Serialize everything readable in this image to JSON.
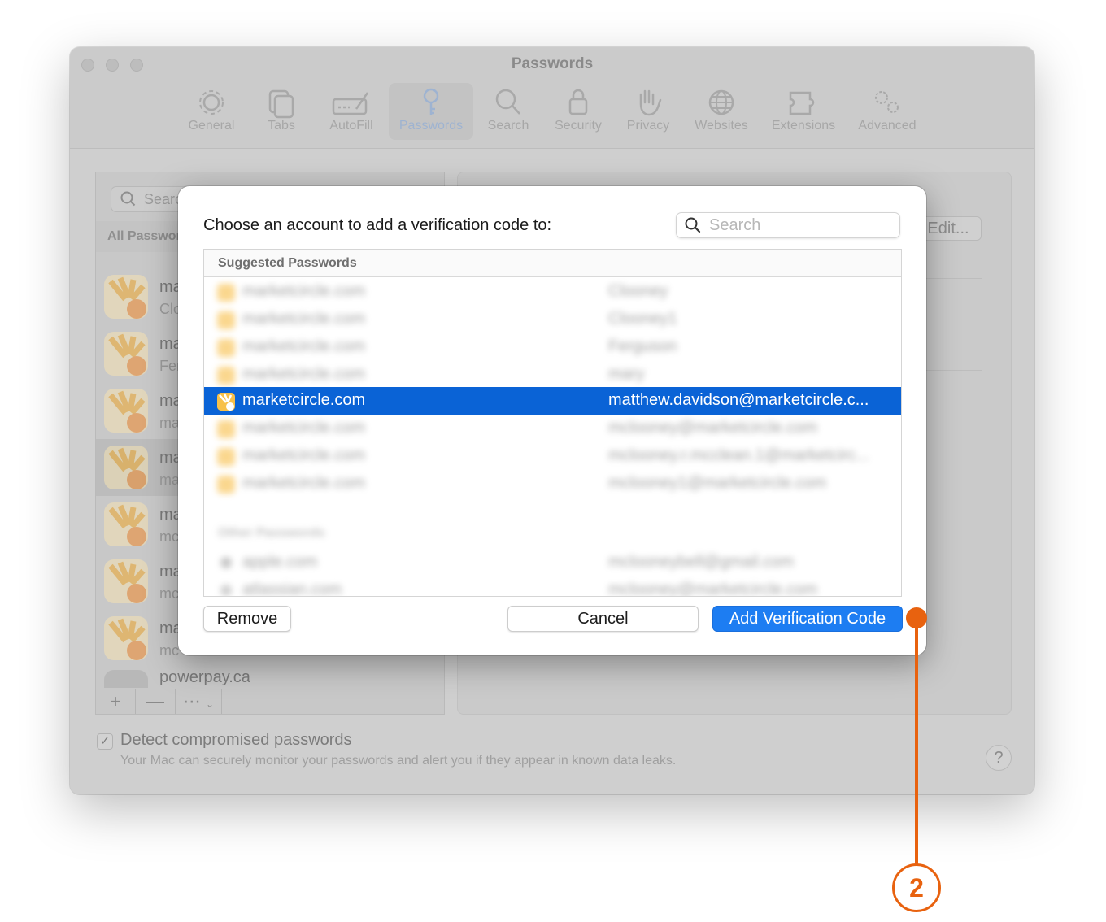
{
  "window": {
    "title": "Passwords",
    "toolbar": [
      {
        "label": "General",
        "icon": "gear-icon"
      },
      {
        "label": "Tabs",
        "icon": "tabs-icon"
      },
      {
        "label": "AutoFill",
        "icon": "autofill-icon"
      },
      {
        "label": "Passwords",
        "icon": "key-icon",
        "active": true
      },
      {
        "label": "Search",
        "icon": "search-icon"
      },
      {
        "label": "Security",
        "icon": "lock-icon"
      },
      {
        "label": "Privacy",
        "icon": "hand-icon"
      },
      {
        "label": "Websites",
        "icon": "globe-icon"
      },
      {
        "label": "Extensions",
        "icon": "puzzle-icon"
      },
      {
        "label": "Advanced",
        "icon": "gears-icon"
      }
    ]
  },
  "sidebar": {
    "search_placeholder": "Search",
    "header": "All Passwords",
    "rows": [
      {
        "title": "ma",
        "subtitle": "Clo"
      },
      {
        "title": "ma",
        "subtitle": "Fer"
      },
      {
        "title": "ma",
        "subtitle": "ma"
      },
      {
        "title": "ma",
        "subtitle": "ma"
      },
      {
        "title": "ma",
        "subtitle": "mc"
      },
      {
        "title": "ma",
        "subtitle": "mc"
      },
      {
        "title": "ma",
        "subtitle": "mc"
      },
      {
        "title": "powerpay.ca",
        "subtitle": ""
      }
    ],
    "footer": {
      "add": "+",
      "remove": "—",
      "more": "⋯"
    }
  },
  "detail": {
    "edit_label": "Edit..."
  },
  "options": {
    "detect_title": "Detect compromised passwords",
    "detect_desc": "Your Mac can securely monitor your passwords and alert you if they appear in known data leaks.",
    "detect_checked": true,
    "help": "?"
  },
  "dialog": {
    "prompt": "Choose an account to add a verification code to:",
    "search_placeholder": "Search",
    "section_header": "Suggested Passwords",
    "rows": [
      {
        "site": "marketcircle.com",
        "user": "Clooney",
        "blurred": true
      },
      {
        "site": "marketcircle.com",
        "user": "Clooney1",
        "blurred": true
      },
      {
        "site": "marketcircle.com",
        "user": "Ferguson",
        "blurred": true
      },
      {
        "site": "marketcircle.com",
        "user": "mary",
        "blurred": true
      },
      {
        "site": "marketcircle.com",
        "user": "matthew.davidson@marketcircle.c...",
        "selected": true
      },
      {
        "site": "marketcircle.com",
        "user": "mclooney@marketcircle.com",
        "blurred": true
      },
      {
        "site": "marketcircle.com",
        "user": "mclooney.r.mcclean.1@marketcirc...",
        "blurred": true
      },
      {
        "site": "marketcircle.com",
        "user": "mclooney1@marketcircle.com",
        "blurred": true
      }
    ],
    "other_header": "Other Passwords",
    "other_rows": [
      {
        "site": "apple.com",
        "user": "mclooneybell@gmail.com"
      },
      {
        "site": "atlassian.com",
        "user": "mclooney@marketcircle.com"
      }
    ],
    "buttons": {
      "remove": "Remove",
      "cancel": "Cancel",
      "add": "Add Verification Code"
    }
  },
  "annotation": {
    "step": "2",
    "color": "#e8620f"
  }
}
